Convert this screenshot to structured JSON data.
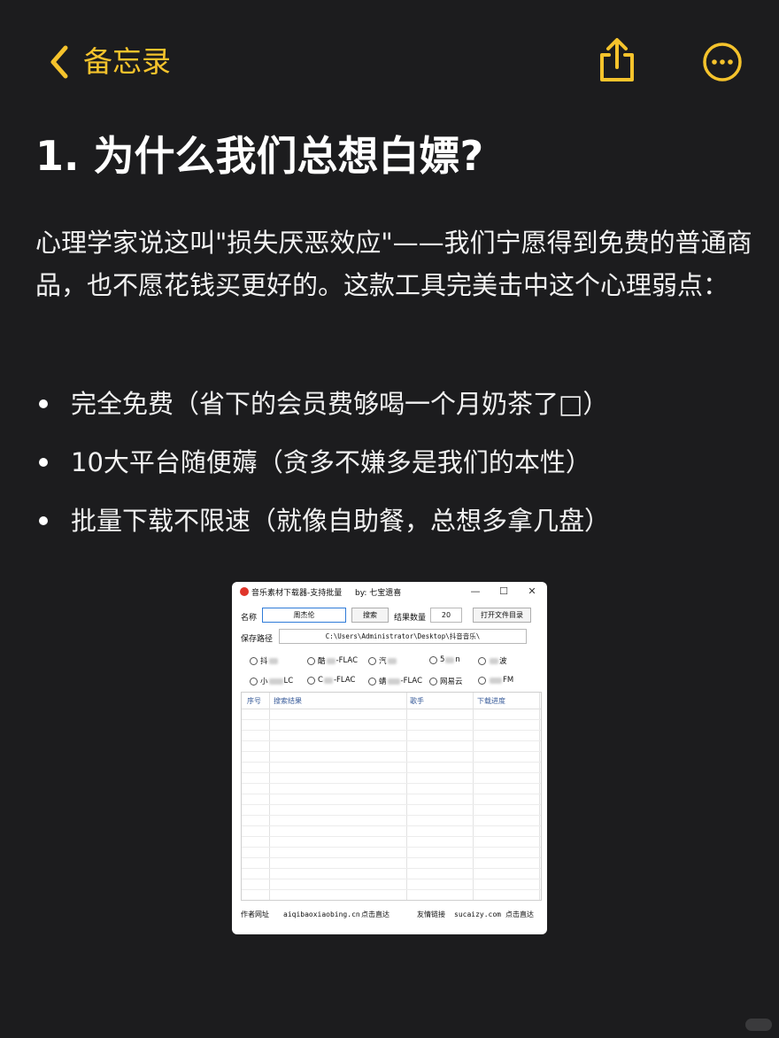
{
  "nav": {
    "back_label": "备忘录",
    "accent_color": "#f5c32c",
    "share_icon": "share-icon",
    "more_icon": "more-icon"
  },
  "note": {
    "title": "1. 为什么我们总想白嫖?",
    "paragraph": "心理学家说这叫\"损失厌恶效应\"——我们宁愿得到免费的普通商品，也不愿花钱买更好的。这款工具完美击中这个心理弱点：",
    "bullets": [
      "完全免费（省下的会员费够喝一个月奶茶了□）",
      "10大平台随便薅（贪多不嫌多是我们的本性）",
      "批量下载不限速（就像自助餐，总想多拿几盘）"
    ]
  },
  "app": {
    "title": "音乐素材下载器-支持批量",
    "by": "by: 七宝遗喜",
    "minimize": "—",
    "maximize": "☐",
    "close": "✕",
    "name_label": "名称",
    "name_value": "周杰伦",
    "search_button": "搜索",
    "count_label": "结果数量",
    "count_value": "20",
    "open_dir_button": "打开文件目录",
    "path_label": "保存路径",
    "path_value": "C:\\Users\\Administrator\\Desktop\\抖音音乐\\",
    "platforms_row1": [
      {
        "pre": "抖",
        "post": ""
      },
      {
        "pre": "酷",
        "post": "-FLAC"
      },
      {
        "pre": "汽",
        "post": ""
      },
      {
        "pre": "5",
        "post": "n"
      },
      {
        "pre": "",
        "post": "波"
      }
    ],
    "platforms_row2": [
      {
        "pre": "小",
        "post": "LC"
      },
      {
        "pre": "C",
        "post": "-FLAC"
      },
      {
        "pre": "蜻",
        "post": "-FLAC"
      },
      {
        "pre": "网易云",
        "post": ""
      },
      {
        "pre": "",
        "post": "FM"
      }
    ],
    "columns": [
      "序号",
      "搜索结果",
      "歌手",
      "下载进度"
    ],
    "footer": {
      "author_label": "作者网址",
      "author_url": "aiqibaoxiaobing.cn",
      "author_link": "点击直达",
      "friend_label": "友情链接",
      "friend_url": "sucaizy.com",
      "friend_link": "点击直达"
    }
  }
}
